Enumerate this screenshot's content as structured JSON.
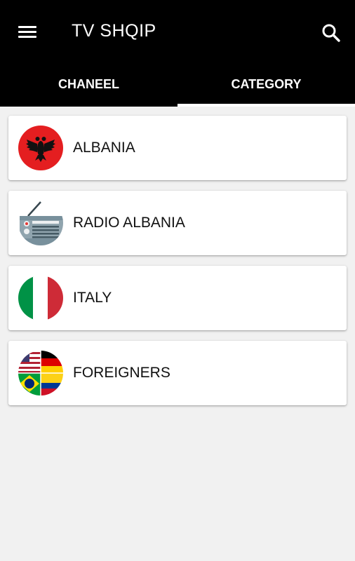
{
  "app": {
    "title": "TV SHQIP"
  },
  "icons": {
    "menu": "menu-icon",
    "search": "search-icon"
  },
  "tabs": [
    {
      "label": "CHANEEL",
      "selected": false
    },
    {
      "label": "CATEGORY",
      "selected": true
    }
  ],
  "categories": [
    {
      "label": "ALBANIA",
      "icon": "albania-flag-icon"
    },
    {
      "label": "RADIO ALBANIA",
      "icon": "radio-icon"
    },
    {
      "label": "ITALY",
      "icon": "italy-flag-icon"
    },
    {
      "label": "FOREIGNERS",
      "icon": "foreign-flags-icon"
    }
  ],
  "colors": {
    "appbar": "#000000",
    "background": "#f1f1f1",
    "albania_red": "#e41e20",
    "italy_green": "#009246",
    "italy_red": "#ce2b37"
  }
}
